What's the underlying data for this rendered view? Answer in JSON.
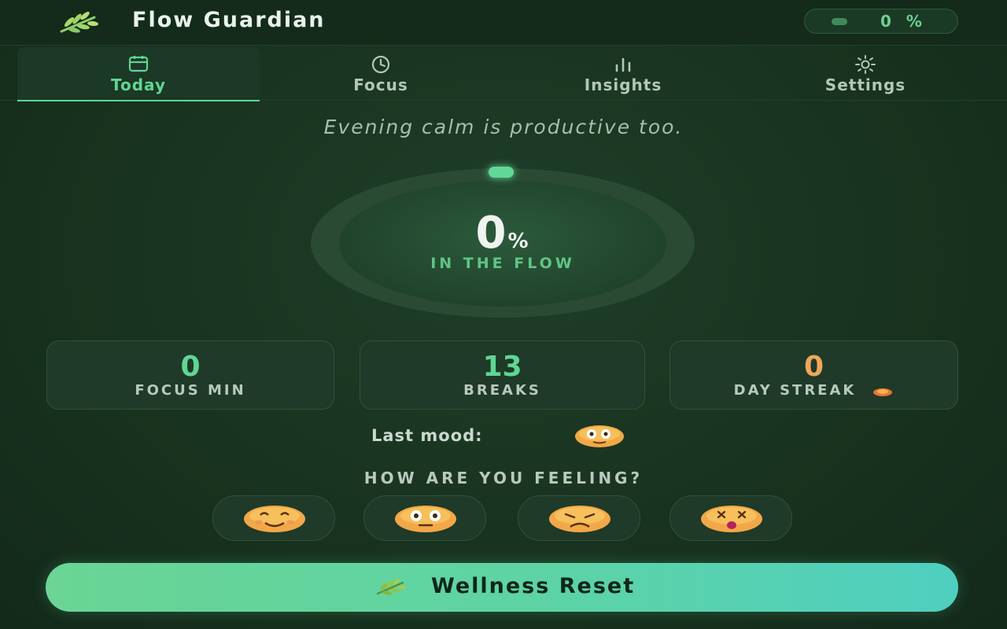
{
  "header": {
    "title": "Flow Guardian",
    "flow_pill": "0 %",
    "logo_icon": "leaf-sprig-icon"
  },
  "tabs": [
    {
      "label": "Today",
      "icon": "calendar-icon",
      "active": true
    },
    {
      "label": "Focus",
      "icon": "clock-icon",
      "active": false
    },
    {
      "label": "Insights",
      "icon": "bar-chart-icon",
      "active": false
    },
    {
      "label": "Settings",
      "icon": "sun-gear-icon",
      "active": false
    }
  ],
  "motto": "Evening calm is productive too.",
  "ring": {
    "value": "0",
    "unit": "%",
    "caption": "IN THE FLOW",
    "progress": 0
  },
  "stats": [
    {
      "value": "0",
      "label": "FOCUS MIN",
      "color": "#5fd693"
    },
    {
      "value": "13",
      "label": "BREAKS",
      "color": "#5fd693"
    },
    {
      "value": "0",
      "label": "DAY STREAK",
      "color": "#f0a65a",
      "icon": "fire-icon"
    }
  ],
  "last_mood": {
    "label": "Last mood:",
    "icon": "neutral-face-icon"
  },
  "feeling": {
    "prompt": "HOW ARE YOU FEELING?",
    "options": [
      "smiling-face-icon",
      "neutral-face-icon",
      "sad-face-icon",
      "dizzy-face-icon"
    ]
  },
  "reset_button": {
    "label": "Wellness Reset",
    "icon": "leaf-sprig-icon"
  },
  "colors": {
    "accent": "#5fd693",
    "background": "#18331f",
    "streak": "#f0a65a"
  }
}
